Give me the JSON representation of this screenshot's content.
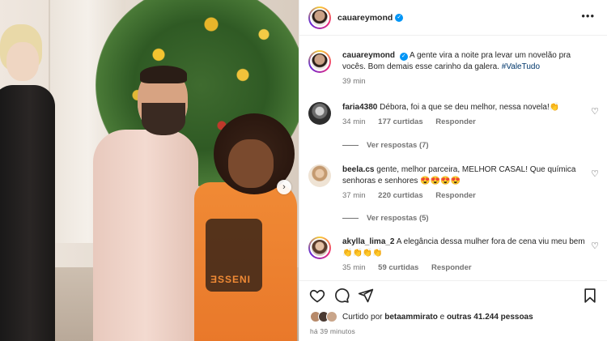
{
  "post": {
    "username": "cauareymond",
    "caption": "A gente vira a noite pra levar um novelão pra vocês. Bom demais esse carinho da galera.",
    "hashtag": "#ValeTudo",
    "caption_time": "39 min",
    "shirt_print": "ƎSSENI"
  },
  "comments": [
    {
      "username": "faria4380",
      "text": "Débora, foi a que se deu melhor, nessa novela!👏",
      "time": "34 min",
      "likes": "177 curtidas",
      "reply": "Responder",
      "view_replies": "Ver respostas (7)"
    },
    {
      "username": "beela.cs",
      "text": "gente, melhor parceira, MELHOR CASAL! Que química senhoras e senhores 😍😍😍😍",
      "time": "37 min",
      "likes": "220 curtidas",
      "reply": "Responder",
      "view_replies": "Ver respostas (5)"
    },
    {
      "username": "akylla_lima_2",
      "text": "A elegância dessa mulher fora de cena viu meu bem 👏👏👏👏",
      "time": "35 min",
      "likes": "59 curtidas",
      "reply": "Responder"
    }
  ],
  "liked_by": {
    "prefix": "Curtido por",
    "user": "betaammirato",
    "connector": "e",
    "others": "outras 41.244 pessoas"
  },
  "post_age": "há 39 minutos",
  "icons": {
    "like": "heart-icon",
    "comment": "comment-icon",
    "share": "share-icon",
    "save": "bookmark-icon",
    "more": "more-options-icon",
    "next": "chevron-right-icon",
    "verified": "verified-badge-icon"
  },
  "colors": {
    "link": "#00376b",
    "verified": "#0095f6",
    "muted": "#737373"
  }
}
